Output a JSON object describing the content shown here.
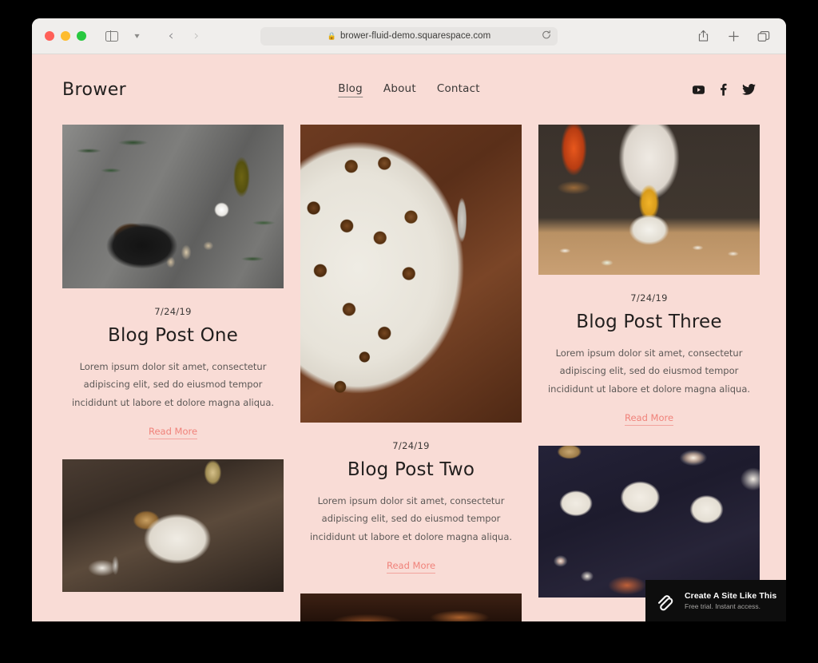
{
  "browser": {
    "url": "brower-fluid-demo.squarespace.com",
    "lock_icon": "lock-icon",
    "reload_icon": "reload-icon",
    "sidebar_icon": "sidebar-toggle-icon",
    "tab_dropdown_icon": "chevron-down-icon",
    "back_icon": "back-arrow-icon",
    "forward_icon": "forward-arrow-icon",
    "share_icon": "share-icon",
    "new_tab_icon": "plus-icon",
    "tabs_icon": "tab-overview-icon",
    "traffic_lights": {
      "close": "#ff5f57",
      "minimize": "#febc2e",
      "maximize": "#28c840"
    }
  },
  "site": {
    "logo": "Brower",
    "background_color": "#f9dcd6",
    "accent_color": "#f0827a",
    "nav": [
      {
        "label": "Blog",
        "active": true
      },
      {
        "label": "About",
        "active": false
      },
      {
        "label": "Contact",
        "active": false
      }
    ],
    "social": [
      {
        "name": "youtube-icon"
      },
      {
        "name": "facebook-icon"
      },
      {
        "name": "twitter-icon"
      }
    ]
  },
  "posts": [
    {
      "date": "7/24/19",
      "title": "Blog Post One",
      "excerpt": "Lorem ipsum dolor sit amet, consectetur adipiscing elit, sed do eiusmod tempor incididunt ut labore et dolore magna aliqua.",
      "read_more": "Read More",
      "image_alt": "bread-knife-olive-oil-photo"
    },
    {
      "date": "7/24/19",
      "title": "Blog Post Two",
      "excerpt": "Lorem ipsum dolor sit amet, consectetur adipiscing elit, sed do eiusmod tempor incididunt ut labore et dolore magna aliqua.",
      "read_more": "Read More",
      "image_alt": "escargot-plate-photo"
    },
    {
      "date": "7/24/19",
      "title": "Blog Post Three",
      "excerpt": "Lorem ipsum dolor sit amet, consectetur adipiscing elit, sed do eiusmod tempor incididunt ut labore et dolore magna aliqua.",
      "read_more": "Read More",
      "image_alt": "chef-ramen-noodles-photo"
    },
    {
      "image_alt": "mussels-bowl-wine-photo"
    },
    {
      "image_alt": "party-table-spread-photo"
    },
    {
      "image_alt": "partial-food-photo"
    }
  ],
  "promo": {
    "logo_icon": "squarespace-logo-icon",
    "title": "Create A Site Like This",
    "subtitle": "Free trial. Instant access."
  }
}
